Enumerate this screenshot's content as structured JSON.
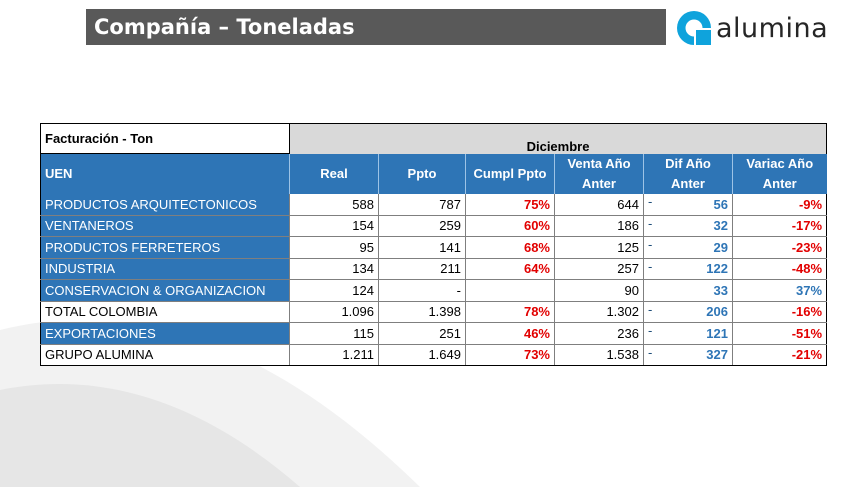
{
  "header": {
    "title": "Compañía – Toneladas",
    "logo_text": "alumina"
  },
  "table": {
    "header_label": "Facturación - Ton",
    "month": "Diciembre",
    "uen_label": "UEN",
    "columns": {
      "real": "Real",
      "ppto": "Ppto",
      "cumpl": "Cumpl Ppto",
      "venta_1": "Venta Año",
      "venta_2": "Anter",
      "dif_1": "Dif Año",
      "dif_2": "Anter",
      "var_1": "Variac Año",
      "var_2": "Anter"
    },
    "rows": [
      {
        "name": "PRODUCTOS ARQUITECTONICOS",
        "real": "588",
        "ppto": "787",
        "cumpl": "75%",
        "venta": "644",
        "dif_dash": "-",
        "dif": "56",
        "var": "-9%"
      },
      {
        "name": "VENTANEROS",
        "real": "154",
        "ppto": "259",
        "cumpl": "60%",
        "venta": "186",
        "dif_dash": "-",
        "dif": "32",
        "var": "-17%"
      },
      {
        "name": "PRODUCTOS FERRETEROS",
        "real": "95",
        "ppto": "141",
        "cumpl": "68%",
        "venta": "125",
        "dif_dash": "-",
        "dif": "29",
        "var": "-23%"
      },
      {
        "name": "INDUSTRIA",
        "real": "134",
        "ppto": "211",
        "cumpl": "64%",
        "venta": "257",
        "dif_dash": "-",
        "dif": "122",
        "var": "-48%"
      },
      {
        "name": "CONSERVACION & ORGANIZACION",
        "real": "124",
        "ppto": "-",
        "cumpl": "",
        "venta": "90",
        "dif_dash": "",
        "dif": "33",
        "var": "37%"
      },
      {
        "name": "TOTAL COLOMBIA",
        "real": "1.096",
        "ppto": "1.398",
        "cumpl": "78%",
        "venta": "1.302",
        "dif_dash": "-",
        "dif": "206",
        "var": "-16%"
      },
      {
        "name": "EXPORTACIONES",
        "real": "115",
        "ppto": "251",
        "cumpl": "46%",
        "venta": "236",
        "dif_dash": "-",
        "dif": "121",
        "var": "-51%"
      },
      {
        "name": "GRUPO ALUMINA",
        "real": "1.211",
        "ppto": "1.649",
        "cumpl": "73%",
        "venta": "1.538",
        "dif_dash": "-",
        "dif": "327",
        "var": "-21%"
      }
    ]
  },
  "colors": {
    "title_bg": "#595959",
    "uen_blue": "#2e75b6",
    "negative_red": "#e20000",
    "positive_blue": "#2e75b6",
    "logo_blue": "#0fa3dc"
  }
}
